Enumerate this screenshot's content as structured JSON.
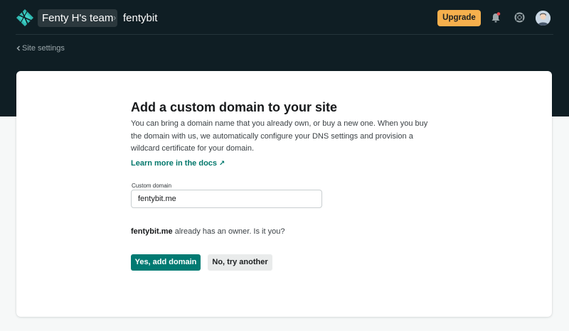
{
  "colors": {
    "header_bg": "#0f1e24",
    "accent_teal": "#007a72",
    "upgrade_orange": "#f6b04d",
    "notification_dot": "#e5484d"
  },
  "header": {
    "logo_icon": "netlify-logo-icon",
    "team_name": "Fenty H's team",
    "breadcrumb_separator": "›",
    "site_name": "fentybit",
    "upgrade_label": "Upgrade",
    "bell_icon": "bell-icon",
    "help_icon": "lifebuoy-icon",
    "avatar": "user-avatar"
  },
  "back_link": {
    "icon": "chevron-left-icon",
    "label": "Site settings"
  },
  "card": {
    "title": "Add a custom domain to your site",
    "description": "You can bring a domain name that you already own, or buy a new one. When you buy the domain with us, we automatically configure your DNS settings and provision a wildcard certificate for your domain.",
    "docs_link_label": "Learn more in the docs",
    "docs_link_arrow": "↗",
    "field_label": "Custom domain",
    "domain_value": "fentybit.me",
    "owner_domain": "fentybit.me",
    "owner_message": " already has an owner. Is it you?",
    "primary_button": "Yes, add domain",
    "secondary_button": "No, try another"
  }
}
